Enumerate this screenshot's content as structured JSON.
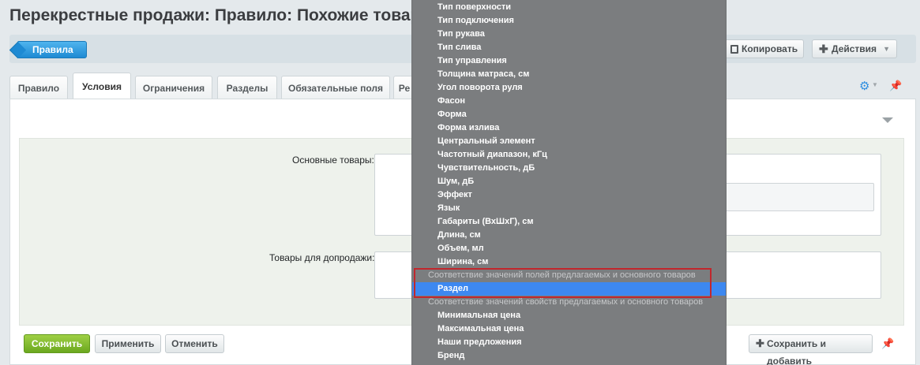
{
  "header": {
    "title": "Перекрестные продажи: Правило: Похожие товары то"
  },
  "toolbar": {
    "back_label": "Правила",
    "copy_label": "Копировать",
    "actions_label": "Действия"
  },
  "tabs": [
    {
      "label": "Правило"
    },
    {
      "label": "Условия"
    },
    {
      "label": "Ограничения"
    },
    {
      "label": "Разделы"
    },
    {
      "label": "Обязательные поля"
    },
    {
      "label": "Ре"
    }
  ],
  "form": {
    "main_goods_label": "Основные товары:",
    "upsell_goods_label": "Товары для допродажи:"
  },
  "footer": {
    "save_label": "Сохранить",
    "apply_label": "Применить",
    "cancel_label": "Отменить",
    "save_add_label": "Сохранить и добавить"
  },
  "dropdown": {
    "items_top": [
      "Тип поверхности",
      "Тип подключения",
      "Тип рукава",
      "Тип слива",
      "Тип управления",
      "Толщина матраса, см",
      "Угол поворота руля",
      "Фасон",
      "Форма",
      "Форма излива",
      "Центральный элемент",
      "Частотный диапазон, кГц",
      "Чувствительность, дБ",
      "Шум, дБ",
      "Эффект",
      "Язык",
      "Габариты (ВхШхГ), см",
      "Длина, см",
      "Объем, мл",
      "Ширина, см"
    ],
    "group_fields": "Соответствие значений полей предлагаемых и основного товаров",
    "selected_item": "Раздел",
    "group_props": "Соответствие значений свойств предлагаемых и основного товаров",
    "items_bottom": [
      "Минимальная цена",
      "Максимальная цена",
      "Наши предложения",
      "Бренд"
    ]
  },
  "colors": {
    "accent": "#1e8ad3",
    "save_green": "#7ab82a",
    "selected_blue": "#3d88f0",
    "highlight_red": "#c1272d"
  }
}
